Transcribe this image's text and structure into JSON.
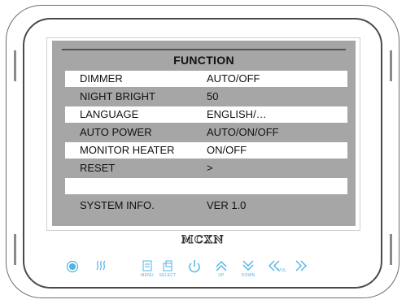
{
  "title": "FUNCTION",
  "menu": [
    {
      "label": "DIMMER",
      "value": "AUTO/OFF"
    },
    {
      "label": "NIGHT BRIGHT",
      "value": "50"
    },
    {
      "label": "LANGUAGE",
      "value": "ENGLISH/…"
    },
    {
      "label": "AUTO POWER",
      "value": "AUTO/ON/OFF"
    },
    {
      "label": "MONITOR HEATER",
      "value": "ON/OFF"
    },
    {
      "label": "RESET",
      "value": ">"
    },
    {
      "label": "",
      "value": ""
    },
    {
      "label": "SYSTEM INFO.",
      "value": "VER 1.0"
    }
  ],
  "brand": "MCXN",
  "buttons": {
    "menu": "MENU",
    "select": "SELECT",
    "up": "UP",
    "down": "DOWN",
    "vol": "VOL"
  },
  "colors": {
    "accent": "#4fb3e6",
    "screen": "#a6a6a6",
    "highlight": "#ffffff"
  }
}
